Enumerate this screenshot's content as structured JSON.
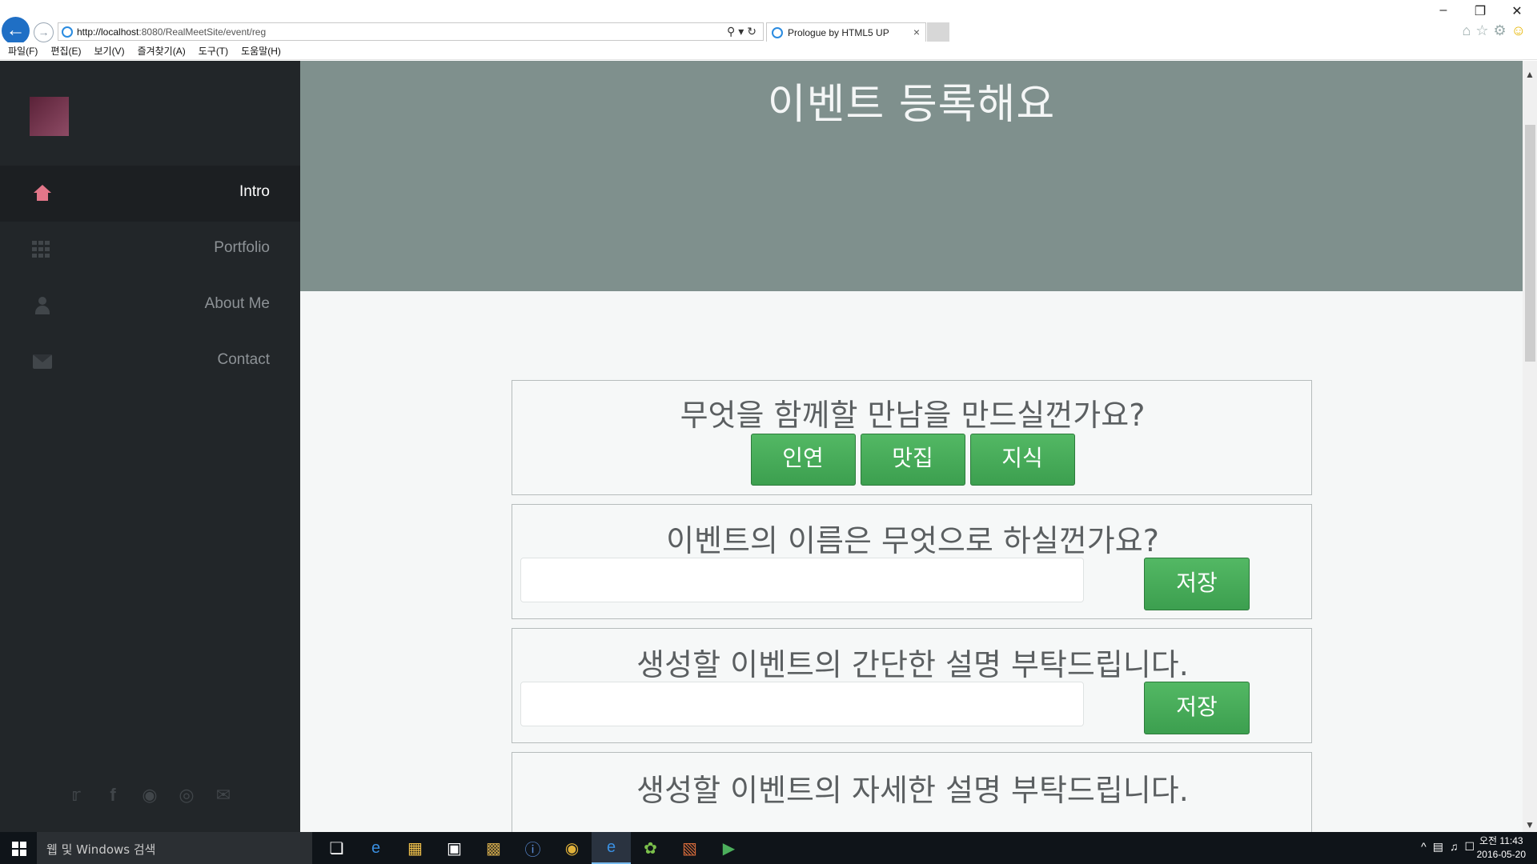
{
  "browser": {
    "url_host": "http://localhost",
    "url_path": ":8080/RealMeetSite/event/reg",
    "tab_title": "Prologue by HTML5 UP",
    "menu": [
      "파일(F)",
      "편집(E)",
      "보기(V)",
      "즐겨찾기(A)",
      "도구(T)",
      "도움말(H)"
    ]
  },
  "sidebar": {
    "nav": [
      {
        "label": "Intro",
        "icon": "home-icon",
        "active": true
      },
      {
        "label": "Portfolio",
        "icon": "grid-icon",
        "active": false
      },
      {
        "label": "About Me",
        "icon": "user-icon",
        "active": false
      },
      {
        "label": "Contact",
        "icon": "envelope-icon",
        "active": false
      }
    ],
    "social_icons": [
      "twitter-icon",
      "facebook-icon",
      "github-icon",
      "dribbble-icon",
      "email-icon"
    ]
  },
  "main": {
    "banner_title": "이벤트 등록해요",
    "question_type": "무엇을 함께할 만남을 만드실껀가요?",
    "type_options": [
      "인연",
      "맛집",
      "지식"
    ],
    "question_name": "이벤트의 이름은 무엇으로 하실껀가요?",
    "question_short_desc": "생성할 이벤트의 간단한 설명 부탁드립니다.",
    "question_long_desc": "생성할 이벤트의 자세한 설명 부탁드립니다.",
    "save_label": "저장",
    "name_value": "",
    "short_desc_value": ""
  },
  "taskbar": {
    "search_placeholder": "웹 및 Windows 검색",
    "clock_time": "오전 11:43",
    "clock_date": "2016-05-20"
  },
  "colors": {
    "accent_pink": "#e27689",
    "sidebar_bg": "#222629",
    "banner_bg": "#7f908d",
    "button_green": "#4caf5c"
  }
}
